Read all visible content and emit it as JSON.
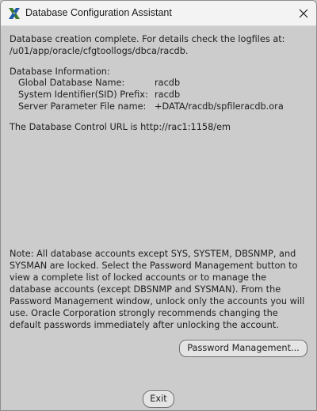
{
  "window": {
    "title": "Database Configuration Assistant"
  },
  "completion": {
    "line1": "Database creation complete. For details check the logfiles at:",
    "line2": " /u01/app/oracle/cfgtoollogs/dbca/racdb."
  },
  "db_info": {
    "heading": "Database Information:",
    "rows": [
      {
        "label": "Global Database Name:",
        "value": "racdb"
      },
      {
        "label": "System Identifier(SID) Prefix:",
        "value": "racdb"
      },
      {
        "label": "Server Parameter File name:",
        "value": "+DATA/racdb/spfileracdb.ora"
      }
    ]
  },
  "control_url": "The Database Control URL is http://rac1:1158/em",
  "note": {
    "lines": [
      "Note: All database accounts except SYS, SYSTEM, DBSNMP, and",
      "SYSMAN are locked. Select the Password Management button to",
      "view a complete list of locked accounts or to manage the",
      "database accounts (except DBSNMP and SYSMAN). From the",
      "Password Management window, unlock only the accounts you will",
      "use. Oracle Corporation strongly recommends changing the",
      "default passwords immediately after unlocking the account."
    ]
  },
  "buttons": {
    "password_management": "Password Management...",
    "exit": "Exit"
  },
  "icons": {
    "app": "oracle-x-logo-icon",
    "close": "close-icon"
  },
  "colors": {
    "background": "#cccccc",
    "titlebar": "#f3f3f3",
    "button": "#e4e4e4"
  }
}
